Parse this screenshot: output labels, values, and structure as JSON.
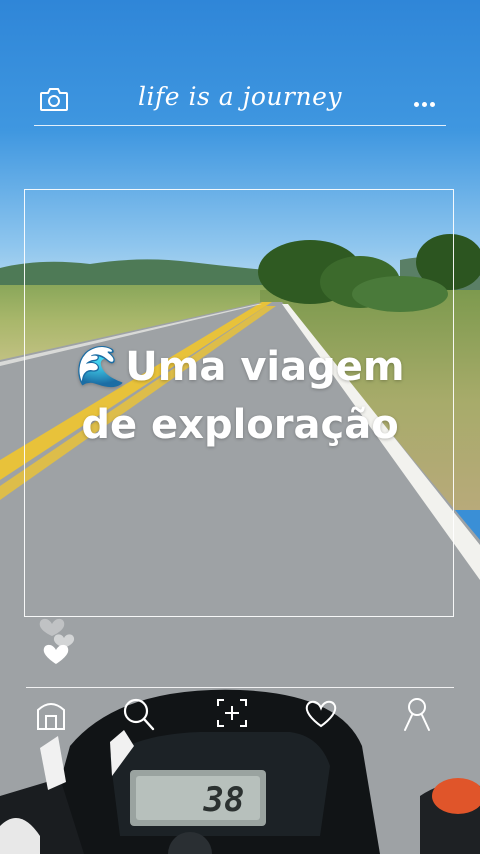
{
  "header": {
    "title": "life is a journey",
    "left_icon": "camera-icon",
    "right_icon": "more-dots-icon"
  },
  "caption": {
    "emoji": "🌊",
    "line1": "Uma viagem",
    "line2": "de exploração"
  },
  "dashboard": {
    "speed_readout": "38"
  },
  "bottom_nav": [
    {
      "icon": "home-icon"
    },
    {
      "icon": "search-icon"
    },
    {
      "icon": "add-post-icon"
    },
    {
      "icon": "heart-icon"
    },
    {
      "icon": "profile-icon"
    }
  ],
  "colors": {
    "sky": "#3f97e0",
    "road": "#9fa3a6",
    "road_line": "#e8c23a",
    "overlay": "#ffffff"
  }
}
